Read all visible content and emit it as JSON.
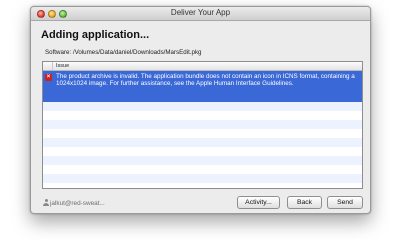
{
  "window": {
    "title": "Deliver Your App"
  },
  "heading": "Adding application...",
  "software": {
    "text": "Software: /Volumes/Data/daniel/Downloads/MarsEdit.pkg"
  },
  "table": {
    "column_header": "Issue",
    "rows": [
      {
        "icon": "error-icon",
        "text": "The product archive is invalid. The application bundle does not contain an icon in ICNS format, containing a 1024x1024 image. For further assistance, see the Apple Human Interface Guidelines.",
        "selected": true
      }
    ]
  },
  "footer": {
    "user": "jalkut@red-sweat...",
    "buttons": {
      "activity": "Activity...",
      "back": "Back",
      "send": "Send"
    }
  },
  "colors": {
    "selection": "#3a68d6",
    "error": "#d21f1f",
    "window_bg": "#ececec"
  }
}
